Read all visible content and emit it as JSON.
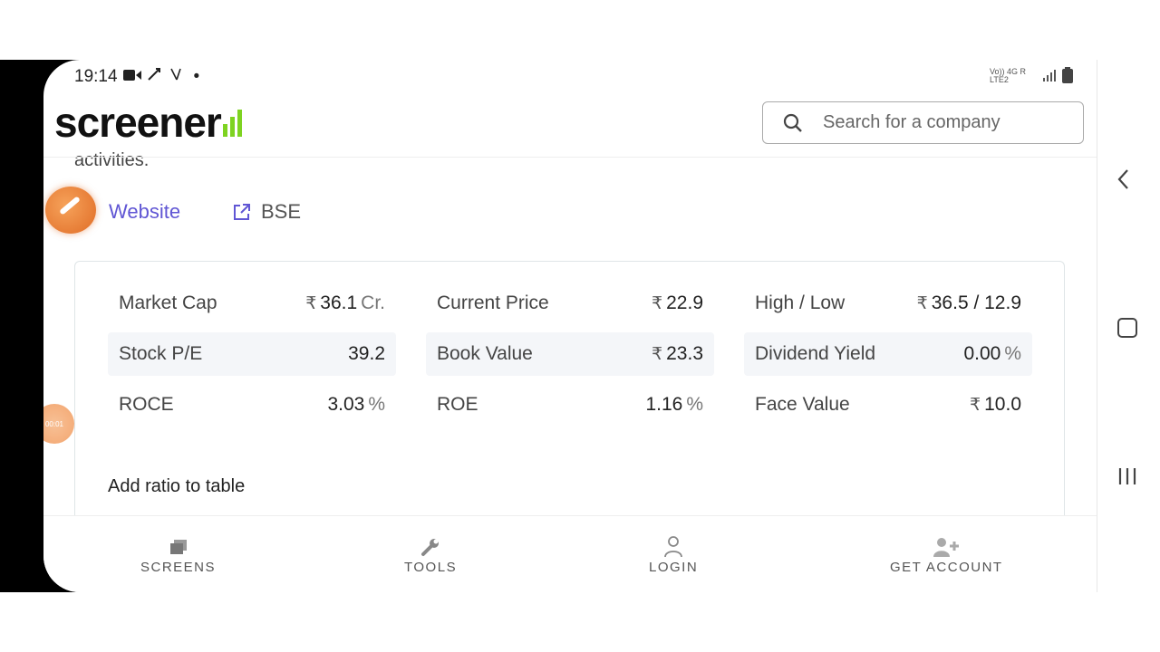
{
  "status_bar": {
    "time": "19:14",
    "indicators": "• ",
    "network": "Vo)) 4G R LTE2",
    "icons": [
      "video-icon",
      "call-forward-icon",
      "antenna-icon",
      "signal-icon",
      "battery-icon"
    ]
  },
  "header": {
    "logo_text": "screener",
    "search_placeholder": "Search for a company"
  },
  "about": {
    "text_tail": "activities."
  },
  "links": {
    "website": "Website",
    "bse": "BSE"
  },
  "ratios": [
    {
      "name": "Market Cap",
      "prefix": "₹",
      "value": "36.1",
      "unit": "Cr."
    },
    {
      "name": "Current Price",
      "prefix": "₹",
      "value": "22.9",
      "unit": ""
    },
    {
      "name": "High / Low",
      "prefix": "₹",
      "value": "36.5 / 12.9",
      "unit": ""
    },
    {
      "name": "Stock P/E",
      "prefix": "",
      "value": "39.2",
      "unit": ""
    },
    {
      "name": "Book Value",
      "prefix": "₹",
      "value": "23.3",
      "unit": ""
    },
    {
      "name": "Dividend Yield",
      "prefix": "",
      "value": "0.00",
      "unit": "%"
    },
    {
      "name": "ROCE",
      "prefix": "",
      "value": "3.03",
      "unit": "%"
    },
    {
      "name": "ROE",
      "prefix": "",
      "value": "1.16",
      "unit": "%"
    },
    {
      "name": "Face Value",
      "prefix": "₹",
      "value": "10.0",
      "unit": ""
    }
  ],
  "add_ratio_label": "Add ratio to table",
  "bottom_nav": [
    {
      "label": "SCREENS",
      "icon": "screens-icon"
    },
    {
      "label": "TOOLS",
      "icon": "wrench-icon"
    },
    {
      "label": "LOGIN",
      "icon": "user-icon"
    },
    {
      "label": "GET ACCOUNT",
      "icon": "add-user-icon"
    }
  ],
  "timer_label": "00:01",
  "colors": {
    "link": "#6056d4",
    "logo_bars": "#7ed321",
    "bubble": "#e06c26"
  }
}
